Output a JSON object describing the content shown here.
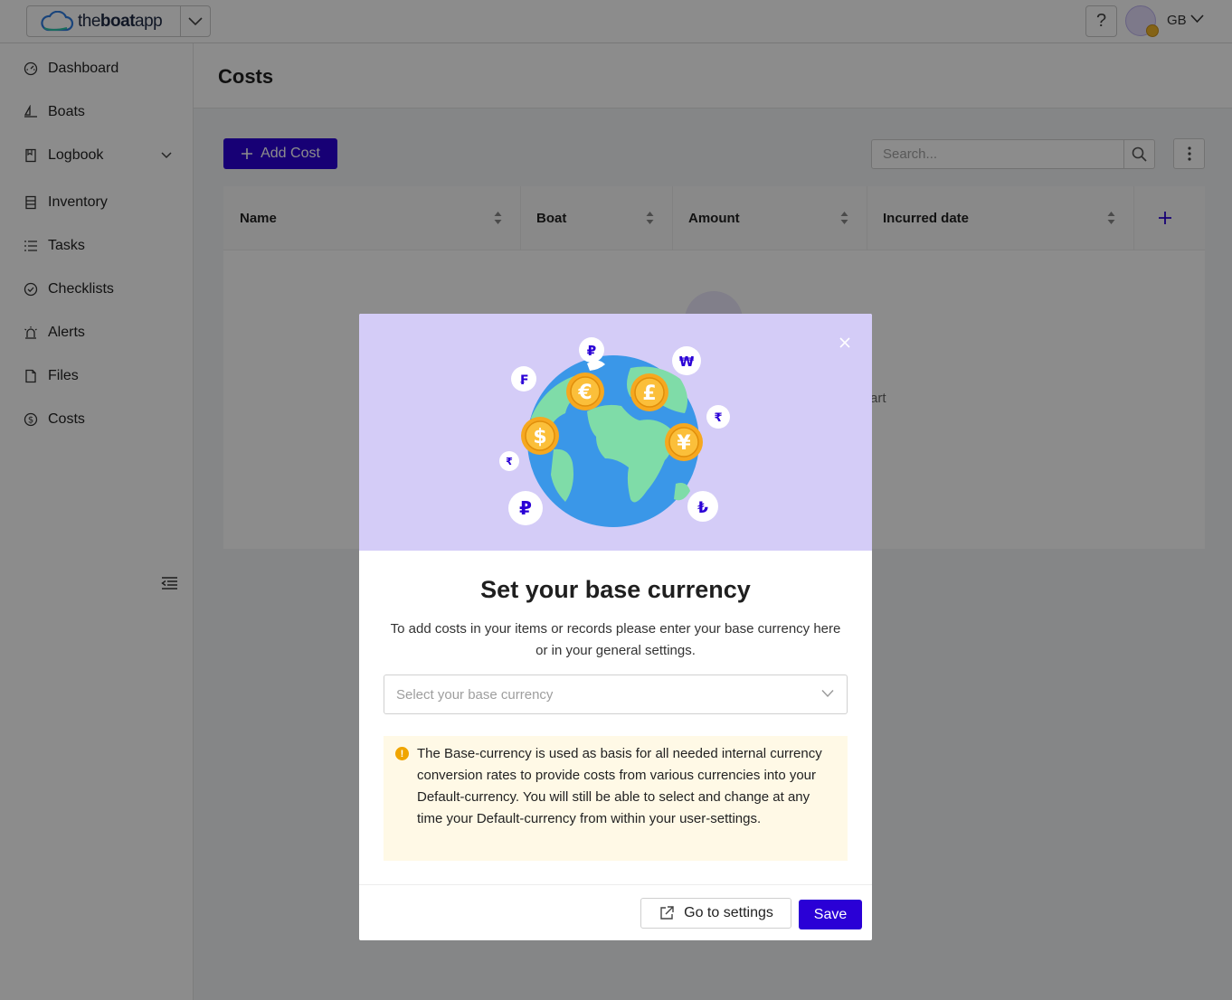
{
  "app": {
    "logo_prefix": "the",
    "logo_bold": "boat",
    "logo_suffix": "app",
    "help_label": "?",
    "user_initials": "GB"
  },
  "sidebar": {
    "items": [
      {
        "label": "Dashboard",
        "icon": "dashboard-icon"
      },
      {
        "label": "Boats",
        "icon": "sailboat-icon"
      },
      {
        "label": "Logbook",
        "icon": "book-icon"
      },
      {
        "label": "Inventory",
        "icon": "inventory-icon"
      },
      {
        "label": "Tasks",
        "icon": "list-icon"
      },
      {
        "label": "Checklists",
        "icon": "check-circle-icon"
      },
      {
        "label": "Alerts",
        "icon": "alarm-icon"
      },
      {
        "label": "Files",
        "icon": "file-icon"
      },
      {
        "label": "Costs",
        "icon": "dollar-circle-icon"
      }
    ]
  },
  "page": {
    "title": "Costs",
    "add_button": "Add Cost",
    "search_placeholder": "Search..."
  },
  "table": {
    "columns": [
      "Name",
      "Boat",
      "Amount",
      "Incurred date"
    ],
    "empty_text_fragment": "art"
  },
  "modal": {
    "title": "Set your base currency",
    "description": "To add costs in your items or records please enter your base currency here or in your general settings.",
    "select_placeholder": "Select your base currency",
    "info_icon": "!",
    "info_text": "The Base-currency is used as basis for all needed internal currency conversion rates to provide costs from various currencies into your Default-currency. You will still be able to select and change at any time your Default-currency from within your user-settings.",
    "goto_button": "Go to settings",
    "save_button": "Save",
    "hero": {
      "coins": [
        "€",
        "£",
        "$",
        "¥"
      ],
      "tokens": [
        "₽",
        "₩",
        "₣",
        "₹",
        "₹",
        "₽",
        "₺"
      ]
    }
  },
  "colors": {
    "accent": "#2a00d6",
    "hero_bg": "#d4ccf7",
    "info_bg": "#fff9e6",
    "coin": "#f6a81f",
    "ocean": "#3a97e8",
    "land": "#7fdca8"
  }
}
